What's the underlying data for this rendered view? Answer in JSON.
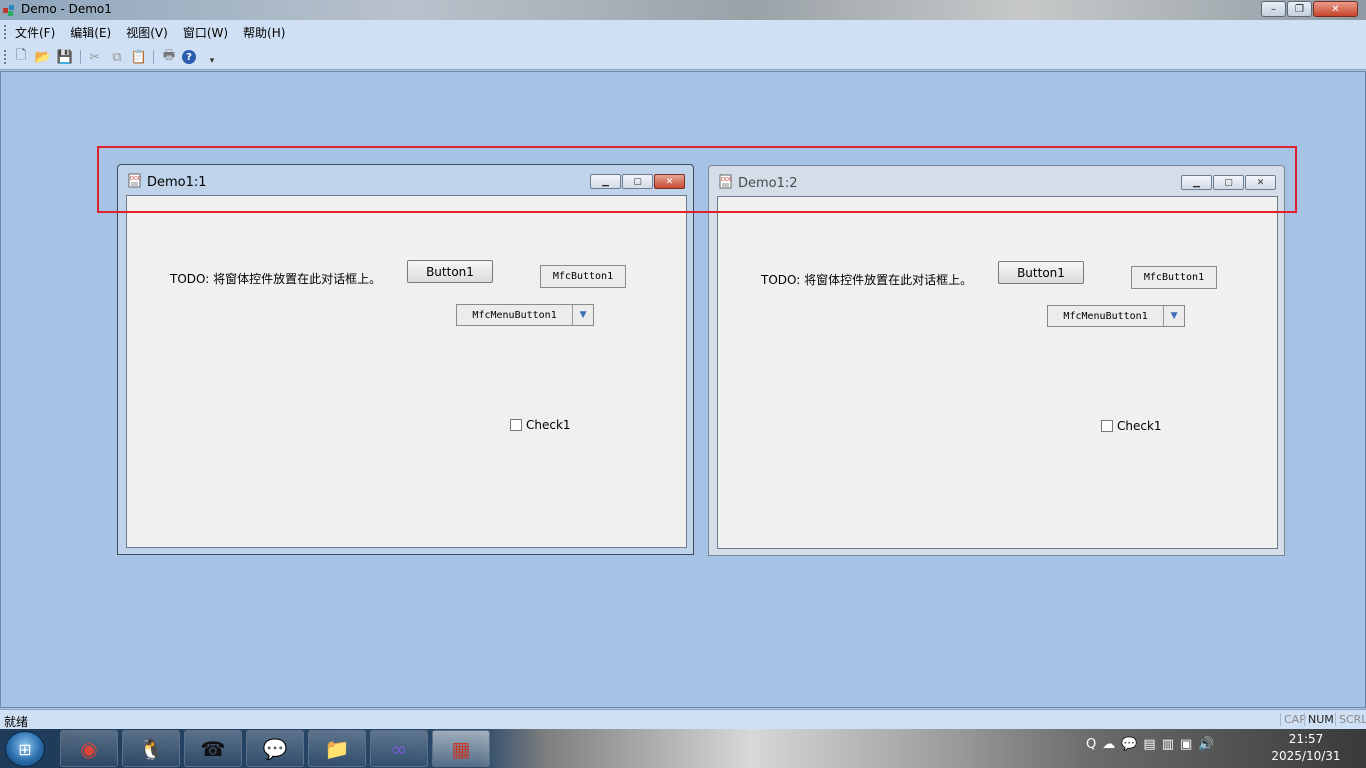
{
  "app": {
    "title": "Demo - Demo1",
    "controls": {
      "minimize": "–",
      "maximize": "❐",
      "close": "✕"
    }
  },
  "menu": [
    "文件(F)",
    "编辑(E)",
    "视图(V)",
    "窗口(W)",
    "帮助(H)"
  ],
  "toolbar": {
    "icons": [
      "new-icon",
      "open-icon",
      "save-icon",
      "cut-icon",
      "copy-icon",
      "paste-icon",
      "print-icon",
      "help-icon",
      "toolbar-options-icon"
    ],
    "glyphs": [
      "🗋",
      "📂",
      "💾",
      "✂",
      "⧉",
      "📋",
      "🖶",
      "?",
      "▾"
    ]
  },
  "children": [
    {
      "title": "Demo1:1",
      "todo": "TODO: 将窗体控件放置在此对话框上。",
      "button1": "Button1",
      "mfc_button": "MfcButton1",
      "mfc_menu_button": "MfcMenuButton1",
      "check": "Check1",
      "active": true
    },
    {
      "title": "Demo1:2",
      "todo": "TODO: 将窗体控件放置在此对话框上。",
      "button1": "Button1",
      "mfc_button": "MfcButton1",
      "mfc_menu_button": "MfcMenuButton1",
      "check": "Check1",
      "active": false
    }
  ],
  "child_controls": {
    "minimize": "▁",
    "maximize": "▢",
    "close": "✕"
  },
  "status": {
    "text": "就绪",
    "indicators": [
      "CAP",
      "NUM",
      "SCRL"
    ]
  },
  "taskbar": {
    "start": "⊞",
    "apps": [
      "chrome-icon",
      "qq-icon",
      "phone-icon",
      "wechat-icon",
      "explorer-icon",
      "visual-studio-icon",
      "mfc-app-icon"
    ],
    "app_glyphs": [
      "◉",
      "🐧",
      "☎",
      "💬",
      "📁",
      "∞",
      "▦"
    ],
    "tray_glyphs": [
      "Q",
      "☁",
      "💬",
      "▤",
      "▥",
      "▣",
      "🔊"
    ],
    "time": "21:57",
    "date": "2025/10/31"
  },
  "colors": {
    "highlight": "#e0202a",
    "mdi_background": "#a6c3e6"
  }
}
